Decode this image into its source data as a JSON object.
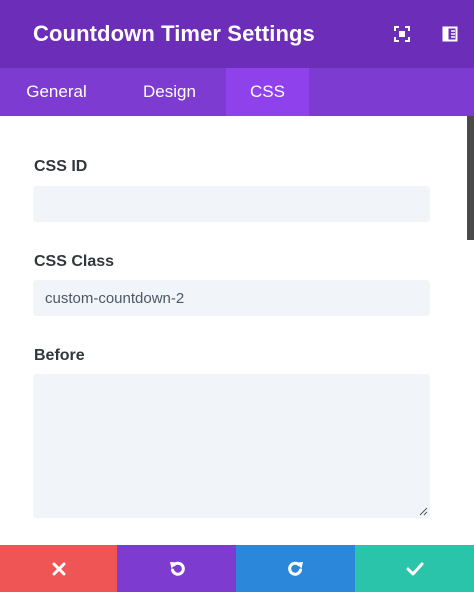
{
  "header": {
    "title": "Countdown Timer Settings",
    "actions": [
      {
        "icon": "expand-icon"
      },
      {
        "icon": "sidebar-layout-icon"
      }
    ]
  },
  "tabs": [
    {
      "label": "General",
      "active": false
    },
    {
      "label": "Design",
      "active": false
    },
    {
      "label": "CSS",
      "active": true
    }
  ],
  "fields": {
    "css_id": {
      "label": "CSS ID",
      "value": ""
    },
    "css_class": {
      "label": "CSS Class",
      "value": "custom-countdown-2"
    },
    "before": {
      "label": "Before",
      "value": ""
    }
  },
  "footer": {
    "buttons": [
      {
        "action": "cancel",
        "icon": "close-icon",
        "color": "#ef5555"
      },
      {
        "action": "undo",
        "icon": "undo-icon",
        "color": "#7e3bd0"
      },
      {
        "action": "redo",
        "icon": "redo-icon",
        "color": "#2b87da"
      },
      {
        "action": "save",
        "icon": "check-icon",
        "color": "#29c4a9"
      }
    ]
  },
  "colors": {
    "header": "#6c2eb9",
    "tabs": "#7d3bd1",
    "active_tab": "#8f42ec",
    "input_bg": "#f1f5f9"
  }
}
